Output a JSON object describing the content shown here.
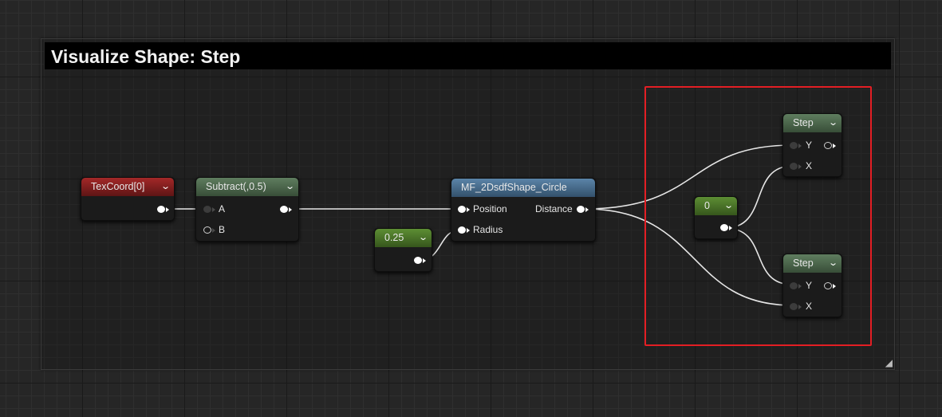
{
  "comment": {
    "title": "Visualize Shape: Step"
  },
  "nodes": {
    "texcoord": {
      "title": "TexCoord[0]",
      "color": "#8a1e1e"
    },
    "subtract": {
      "title": "Subtract(,0.5)",
      "color": "#4d6a4d",
      "pin_a": "A",
      "pin_b": "B"
    },
    "constant_025": {
      "title": "0.25",
      "color": "#4b7a2a"
    },
    "circle": {
      "title": "MF_2DsdfShape_Circle",
      "color": "#4a6f8f",
      "pin_position": "Position",
      "pin_radius": "Radius",
      "pin_distance": "Distance"
    },
    "constant_0": {
      "title": "0",
      "color": "#4b7a2a"
    },
    "step_top": {
      "title": "Step",
      "color": "#4d6a4d",
      "pin_y": "Y",
      "pin_x": "X"
    },
    "step_bottom": {
      "title": "Step",
      "color": "#4d6a4d",
      "pin_y": "Y",
      "pin_x": "X"
    }
  },
  "highlight_color": "#e31e24"
}
